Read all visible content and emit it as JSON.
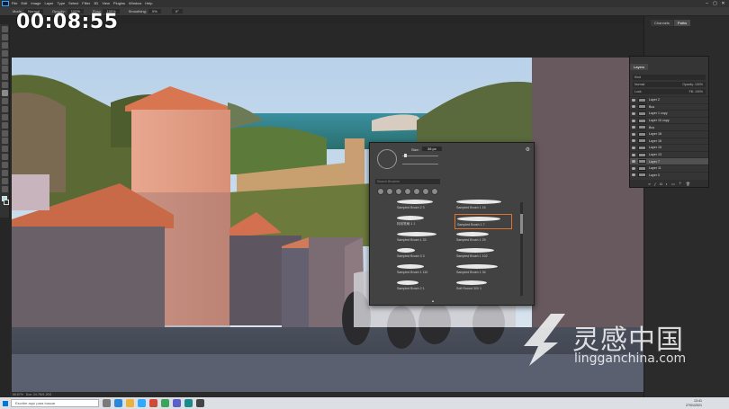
{
  "timer": "00:08:55",
  "menu": {
    "items": [
      "File",
      "Edit",
      "Image",
      "Layer",
      "Type",
      "Select",
      "Filter",
      "3D",
      "View",
      "Plugins",
      "Window",
      "Help"
    ]
  },
  "options": {
    "mode_label": "Mode:",
    "mode_value": "Normal",
    "opacity_label": "Opacity:",
    "opacity_value": "100%",
    "flow_label": "Flow:",
    "flow_value": "100%",
    "smoothing_label": "Smoothing:",
    "smoothing_value": "0%",
    "angle_value": "0°"
  },
  "dock": {
    "tabs": [
      "Channels",
      "Paths"
    ]
  },
  "layers_panel": {
    "tab": "Layers",
    "kind_label": "Kind",
    "blend": "Normal",
    "opacity": "Opacity: 100%",
    "fill": "Fill: 100%",
    "lock_label": "Lock:",
    "layers": [
      {
        "name": "Layer 2"
      },
      {
        "name": "Bus"
      },
      {
        "name": "Layer 1 copy"
      },
      {
        "name": "Layer 10 copy"
      },
      {
        "name": "Bus"
      },
      {
        "name": "Layer 18"
      },
      {
        "name": "Layer 16"
      },
      {
        "name": "Layer 15"
      },
      {
        "name": "Layer 13"
      },
      {
        "name": "Layer 7"
      },
      {
        "name": "Layer 11"
      },
      {
        "name": "Layer 0"
      }
    ],
    "selected_index": 9
  },
  "brush_panel": {
    "size_label": "Size:",
    "size_value": "36 px",
    "search_placeholder": "Search Brushes",
    "brushes": [
      {
        "name": "Sampled Brush 2 3",
        "col": 0,
        "row": 0
      },
      {
        "name": "Sampled Brush 1 16",
        "col": 1,
        "row": 0
      },
      {
        "name": "特效笔刷 1 1",
        "col": 0,
        "row": 1
      },
      {
        "name": "Sampled Brush 1 7",
        "col": 1,
        "row": 1
      },
      {
        "name": "Sampled Brush 1 33",
        "col": 0,
        "row": 2
      },
      {
        "name": "Sampled Brush 1 29",
        "col": 1,
        "row": 2
      },
      {
        "name": "Sampled Brush 3 3",
        "col": 0,
        "row": 3
      },
      {
        "name": "Sampled Brush 1 102",
        "col": 1,
        "row": 3
      },
      {
        "name": "Sampled Brush 1 110",
        "col": 0,
        "row": 4
      },
      {
        "name": "Sampled Brush 1 34",
        "col": 1,
        "row": 4
      },
      {
        "name": "Sampled Brush 2 1",
        "col": 0,
        "row": 5
      },
      {
        "name": "Soft Round 300 1",
        "col": 1,
        "row": 5
      }
    ],
    "selected_index": 3
  },
  "status": {
    "zoom": "66.67%",
    "doc": "Doc: 24.7M/1.20G"
  },
  "taskbar": {
    "search_placeholder": "Escribe aquí para buscar",
    "time": "13:41",
    "date": "27/01/2021"
  },
  "watermark": {
    "cn": "灵感中国",
    "en": "lingganchina.com"
  },
  "colors": {
    "accent_selected": "#e0722b",
    "foreground_swatch": "#a6e2f0",
    "ps_blue": "#31a8ff"
  }
}
